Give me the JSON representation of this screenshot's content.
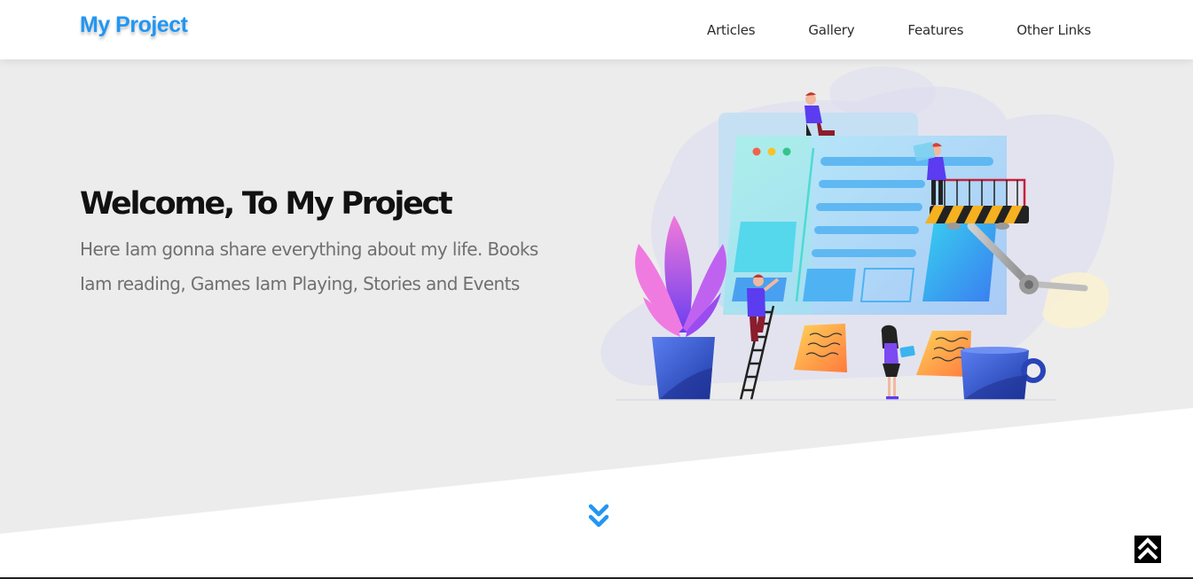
{
  "header": {
    "logo": "My Project",
    "nav": [
      {
        "label": "Articles"
      },
      {
        "label": "Gallery"
      },
      {
        "label": "Features"
      },
      {
        "label": "Other Links"
      }
    ]
  },
  "hero": {
    "title": "Welcome, To My Project",
    "text": "Here Iam gonna share everything about my life. Books Iam reading, Games Iam Playing, Stories and Events"
  },
  "icons": {
    "scroll_down": "double-chevron-down-icon",
    "back_to_top": "double-chevron-up-icon"
  },
  "colors": {
    "brand": "#2196f3",
    "hero_background": "#ececec",
    "title": "#111111",
    "body_text": "#707070"
  }
}
